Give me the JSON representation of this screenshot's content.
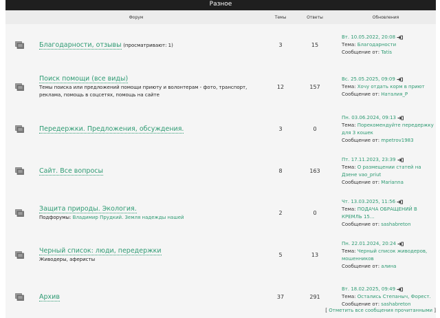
{
  "category": {
    "title": "Разное"
  },
  "columns": {
    "forum": "Форум",
    "topics": "Темы",
    "posts": "Ответы",
    "last": "Обновления"
  },
  "forums": [
    {
      "title": "Благодарности, отзывы",
      "suffix": "(просматривают: 1)",
      "description": "",
      "subforums_label": "",
      "subforums": "",
      "topics": "3",
      "posts": "15",
      "last_date": "Вт. 10.05.2022, 20:08",
      "topic_label": "Тема:",
      "last_topic": "Благодарности",
      "by_label": "Сообщение от:",
      "last_user": "Tatis"
    },
    {
      "title": "Поиск помощи (все виды)",
      "suffix": "",
      "description": "Темы поиска или предложений помощи приюту и волонтерам - фото, транспорт, реклама, помощь в соцсетях, помощь на сайте",
      "subforums_label": "",
      "subforums": "",
      "topics": "12",
      "posts": "157",
      "last_date": "Вс. 25.05.2025, 09:09",
      "topic_label": "Тема:",
      "last_topic": "Хочу отдать корм в приют",
      "by_label": "Сообщение от:",
      "last_user": "Наталия_Р"
    },
    {
      "title": "Передержки. Предложения, обсуждения.",
      "suffix": "",
      "description": "",
      "subforums_label": "",
      "subforums": "",
      "topics": "3",
      "posts": "0",
      "last_date": "Пн. 03.06.2024, 09:13",
      "topic_label": "Тема:",
      "last_topic": "Порекомендуйте передержку для 3 кошек",
      "by_label": "Сообщение от:",
      "last_user": "mpetrov1983"
    },
    {
      "title": "Сайт. Все вопросы",
      "suffix": "",
      "description": "",
      "subforums_label": "",
      "subforums": "",
      "topics": "8",
      "posts": "163",
      "last_date": "Пт. 17.11.2023, 23:39",
      "topic_label": "Тема:",
      "last_topic": "О размещении статей на Дзене vao_priut",
      "by_label": "Сообщение от:",
      "last_user": "Marianna"
    },
    {
      "title": "Защита природы. Экология.",
      "suffix": "",
      "description": "",
      "subforums_label": "Подфорумы:",
      "subforums": "Владимир Прудкий. Земля надежды нашей",
      "topics": "2",
      "posts": "0",
      "last_date": "Чт. 13.03.2025, 11:56",
      "topic_label": "Тема:",
      "last_topic": "ПОДАЧА ОБРАЩЕНИЙ В КРЕМЛЬ 15...",
      "by_label": "Сообщение от:",
      "last_user": "sashabreton"
    },
    {
      "title": "Черный список: люди, передержки",
      "suffix": "",
      "description": "Живодеры, аферисты",
      "subforums_label": "",
      "subforums": "",
      "topics": "5",
      "posts": "13",
      "last_date": "Пн. 22.01.2024, 20:24",
      "topic_label": "Тема:",
      "last_topic": "Черный список живодеров, мошенников",
      "by_label": "Сообщение от:",
      "last_user": "алина"
    },
    {
      "title": "Архив",
      "suffix": "",
      "description": "",
      "subforums_label": "",
      "subforums": "",
      "topics": "37",
      "posts": "291",
      "last_date": "Вт. 18.02.2025, 09:49",
      "topic_label": "Тема:",
      "last_topic": "Остались Степаныч, Форест.",
      "by_label": "Сообщение от:",
      "last_user": "sashabreton"
    }
  ],
  "footer": {
    "pre": "[",
    "mark_read": "Отметить все сообщения прочитанными",
    "post": "]"
  },
  "icons": {
    "forum": "forum-folder-icon",
    "go": "go-to-post-icon"
  },
  "colors": {
    "header_bg": "#1f1f1f",
    "link": "#2d9a72"
  }
}
